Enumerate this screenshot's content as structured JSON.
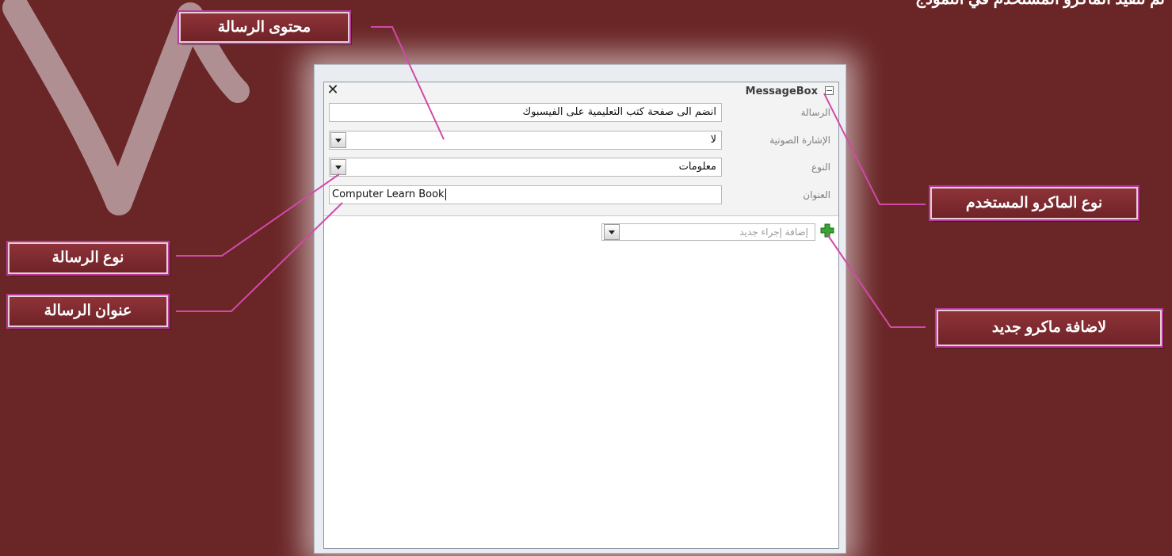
{
  "top_caption": "تم تنفيذ الماكرو المستخدم في النموذج",
  "dialog": {
    "action_title": "MessageBox",
    "close_symbol": "✕",
    "fields": [
      {
        "label": "الرسالة",
        "value": "انضم الى صفحة كتب التعليمية على الفيسبوك",
        "has_dropdown": false
      },
      {
        "label": "الإشارة الصوتية",
        "value": "لا",
        "has_dropdown": true
      },
      {
        "label": "النوع",
        "value": "معلومات",
        "has_dropdown": true
      },
      {
        "label": "العنوان",
        "value": "Computer Learn Book",
        "has_dropdown": false
      }
    ],
    "add_action_placeholder": "إضافة إجراء جديد"
  },
  "callouts": {
    "message_content": "محتوى الرسالة",
    "macro_type": "نوع الماكرو المستخدم",
    "message_type": "نوع الرسالة",
    "message_title": "عنوان الرسالة",
    "add_new_macro": "لاضافة ماكرو جديد"
  },
  "icons": {
    "close": "close-icon",
    "collapse": "collapse-minus-icon",
    "dropdown": "chevron-down-icon",
    "add": "green-plus-icon"
  },
  "colors": {
    "background": "#6a2526",
    "callout_fill": "#7f2b30",
    "callout_outline": "#b63a9c",
    "leader_line": "#d04aa8"
  }
}
